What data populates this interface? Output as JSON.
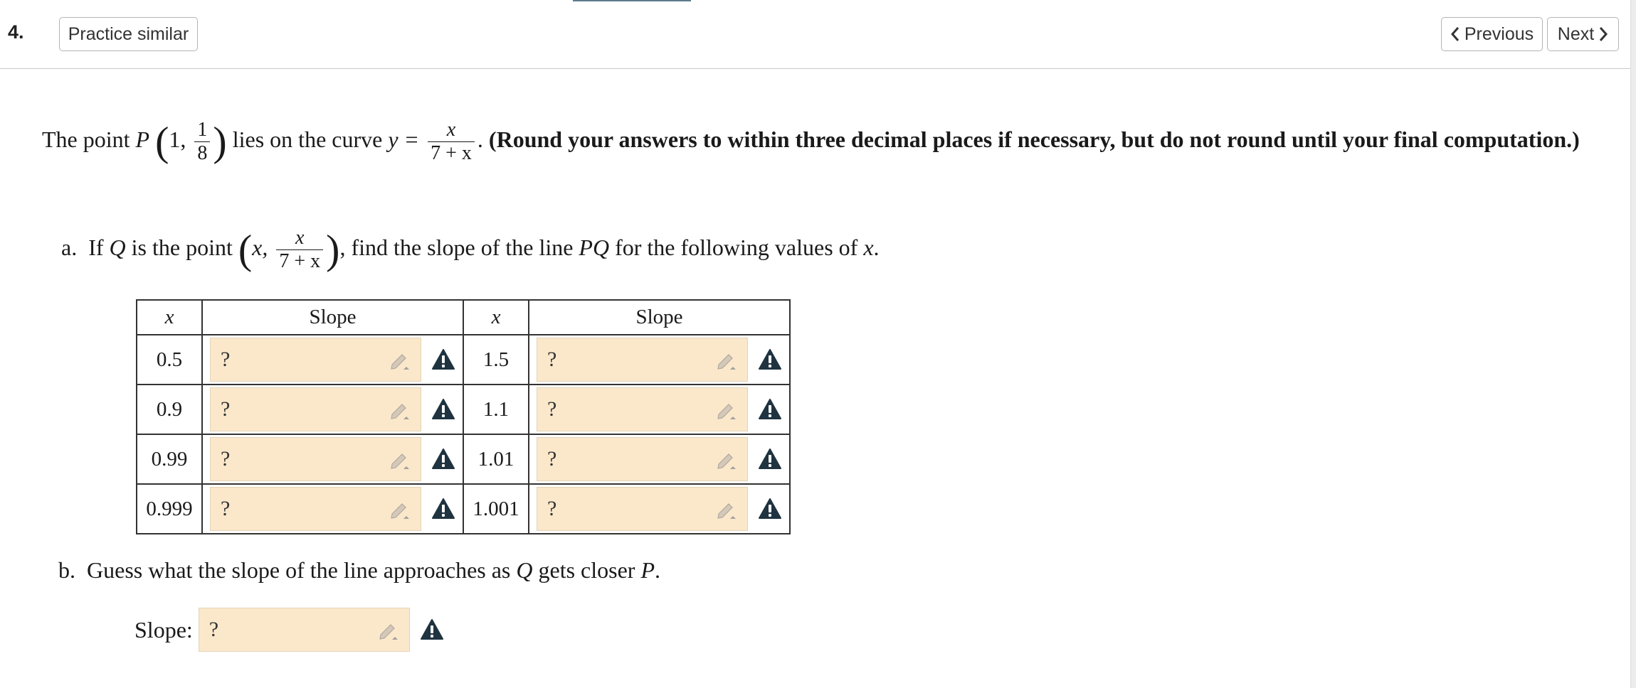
{
  "header": {
    "question_number": "4.",
    "practice_label": "Practice similar",
    "previous_label": "Previous",
    "next_label": "Next"
  },
  "prompt": {
    "intro": "The point",
    "point_name": "P",
    "point_x": "1,",
    "point_y_num": "1",
    "point_y_den": "8",
    "lies_on": "lies on the curve",
    "curve_lhs": "y =",
    "curve_num": "x",
    "curve_den": "7 + x",
    "instructions": "(Round your answers to within three decimal places if necessary, but do not round until your final computation.)"
  },
  "part_a": {
    "label": "a.",
    "text_1": "If",
    "q_name": "Q",
    "text_2": "is the point",
    "q_x": "x,",
    "q_num": "x",
    "q_den": "7 + x",
    "text_3": ", find the slope of the line",
    "line_name": "PQ",
    "text_4": "for the following values of",
    "var": "x",
    "end": "."
  },
  "table": {
    "headers": [
      "x",
      "Slope",
      "x",
      "Slope"
    ],
    "rows": [
      {
        "x1": "0.5",
        "s1": "?",
        "x2": "1.5",
        "s2": "?"
      },
      {
        "x1": "0.9",
        "s1": "?",
        "x2": "1.1",
        "s2": "?"
      },
      {
        "x1": "0.99",
        "s1": "?",
        "x2": "1.01",
        "s2": "?"
      },
      {
        "x1": "0.999",
        "s1": "?",
        "x2": "1.001",
        "s2": "?"
      }
    ]
  },
  "part_b": {
    "label": "b.",
    "text_1": "Guess what the slope of the line approaches as",
    "q_name": "Q",
    "text_2": "gets closer",
    "p_name": "P",
    "end": ".",
    "slope_label": "Slope:",
    "slope_value": "?"
  },
  "colors": {
    "answer_bg": "#fbe8cb",
    "warning_icon": "#1f3340",
    "indicator": "#5d7a8c"
  },
  "icons": [
    "chevron-left-icon",
    "chevron-right-icon",
    "pencil-icon",
    "warning-icon"
  ]
}
